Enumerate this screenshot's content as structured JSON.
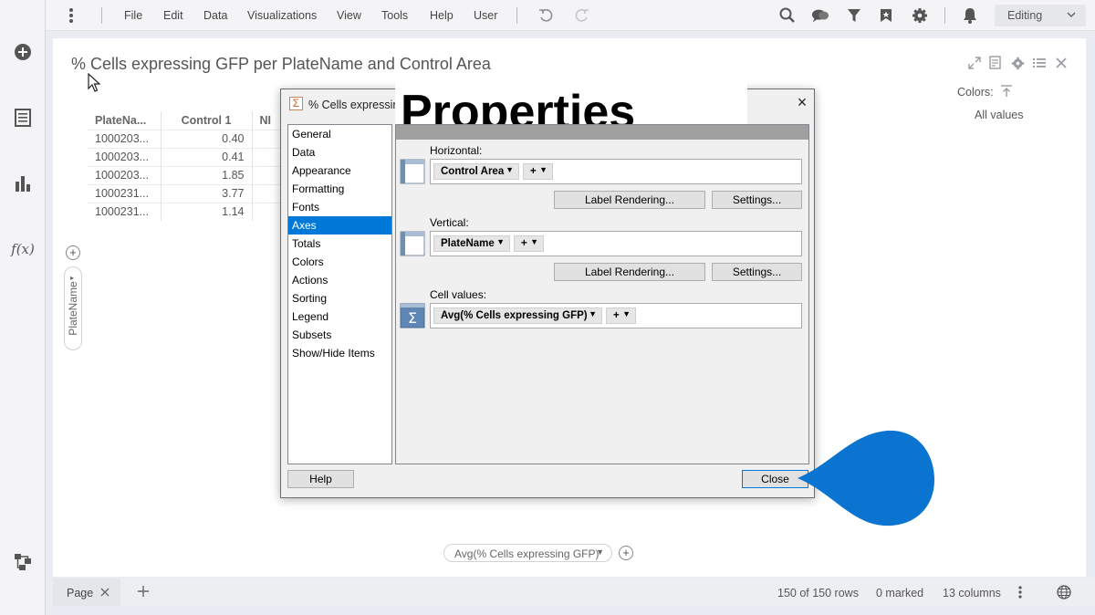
{
  "menubar": {
    "items": [
      "File",
      "Edit",
      "Data",
      "Visualizations",
      "View",
      "Tools",
      "Help",
      "User"
    ],
    "mode": "Editing"
  },
  "leftbar": {
    "icons": [
      "add-icon",
      "data-table-icon",
      "bar-chart-icon",
      "fx-icon",
      "hierarchy-icon"
    ]
  },
  "viz": {
    "title": "% Cells expressing GFP per PlateName and Control Area",
    "colors_label": "Colors:",
    "colors_value": "All values",
    "table": {
      "headers": [
        "PlateNa...",
        "Control 1",
        "NI"
      ],
      "rows": [
        [
          "1000203...",
          "0.40"
        ],
        [
          "1000203...",
          "0.41"
        ],
        [
          "1000203...",
          "1.85"
        ],
        [
          "1000231...",
          "3.77"
        ],
        [
          "1000231...",
          "1.14"
        ]
      ]
    },
    "vertical_axis_label": "PlateName",
    "bottom_axis_label": "Avg(% Cells expressing GFP)"
  },
  "status": {
    "page_tab": "Page",
    "rows": "150 of 150 rows",
    "marked": "0 marked",
    "columns": "13 columns"
  },
  "dialog": {
    "title": "% Cells expressing",
    "heading_overlay": "Properties",
    "categories": [
      "General",
      "Data",
      "Appearance",
      "Formatting",
      "Fonts",
      "Axes",
      "Totals",
      "Colors",
      "Actions",
      "Sorting",
      "Legend",
      "Subsets",
      "Show/Hide Items"
    ],
    "selected_category": "Axes",
    "horizontal": {
      "label": "Horizontal:",
      "column": "Control Area",
      "plus": "+"
    },
    "vertical": {
      "label": "Vertical:",
      "column": "PlateName",
      "plus": "+"
    },
    "cell_values": {
      "label": "Cell values:",
      "column": "Avg(% Cells expressing GFP)",
      "plus": "+"
    },
    "label_rendering_button": "Label Rendering...",
    "settings_button": "Settings...",
    "help_button": "Help",
    "close_button": "Close"
  },
  "colors": {
    "accent": "#0078d7",
    "callout": "#0a74d0"
  }
}
